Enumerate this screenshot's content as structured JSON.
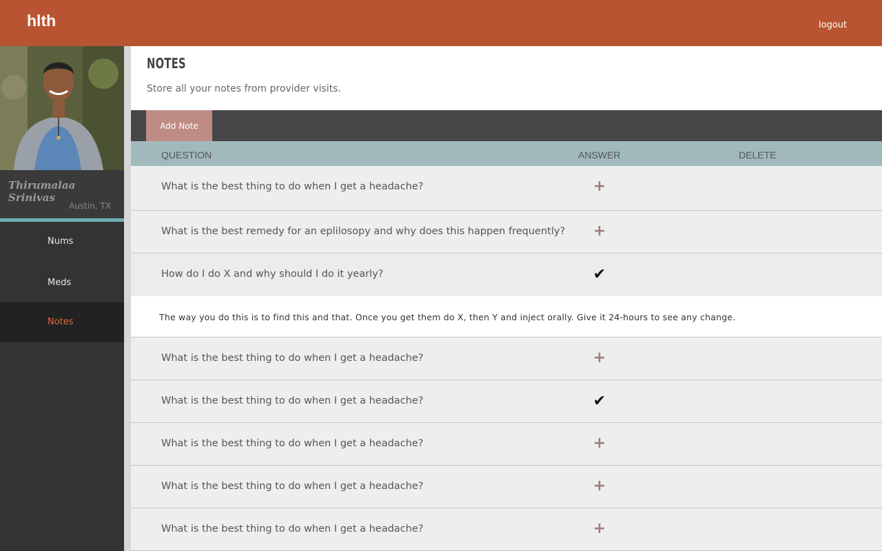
{
  "header": {
    "brand": "hlth",
    "logout": "logout"
  },
  "profile": {
    "name": "Thirumalaa Srinivas",
    "location": "Austin, TX"
  },
  "nav": [
    {
      "label": "Nums",
      "active": false
    },
    {
      "label": "Meds",
      "active": false
    },
    {
      "label": "Notes",
      "active": true
    }
  ],
  "page": {
    "title": "NOTES",
    "subtitle": "Store all your notes from provider visits."
  },
  "toolbar": {
    "add_note": "Add Note"
  },
  "table": {
    "columns": {
      "question": "QUESTION",
      "answer": "ANSWER",
      "delete": "DELETE"
    },
    "rows": [
      {
        "question": "What is the best thing to do when I get a headache?",
        "icon": "plus-icon"
      },
      {
        "question": "What is the best remedy for an eplilosopy and why does this happen frequently?",
        "icon": "plus-icon"
      },
      {
        "question": "How do I do X and why should I do it yearly?",
        "icon": "check-icon",
        "answer": "The way you do this is to find this and that. Once you get them do X, then Y and inject orally. Give it 24-hours to see any change."
      },
      {
        "question": "What is the best thing to do when I get a headache?",
        "icon": "plus-icon"
      },
      {
        "question": "What is the best thing to do when I get a headache?",
        "icon": "check-icon"
      },
      {
        "question": "What is the best thing to do when I get a headache?",
        "icon": "plus-icon"
      },
      {
        "question": "What is the best thing to do when I get a headache?",
        "icon": "plus-icon"
      },
      {
        "question": "What is the best thing to do when I get a headache?",
        "icon": "plus-icon"
      }
    ]
  },
  "colors": {
    "header": "#b85431",
    "accent": "#6fb0b4",
    "active_nav": "#e4673f",
    "button": "#bf8c85",
    "table_head": "#a2b9bc"
  }
}
